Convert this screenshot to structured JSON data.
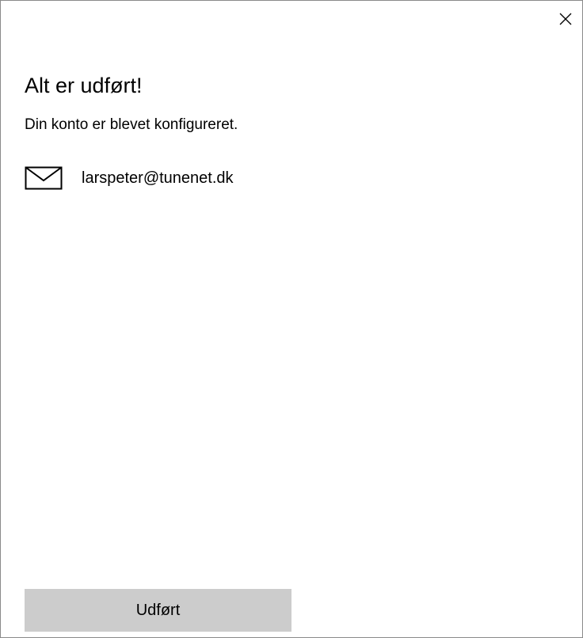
{
  "dialog": {
    "close_icon": "close-icon",
    "title": "Alt er udført!",
    "subtitle": "Din konto er blevet konfigureret.",
    "account": {
      "icon": "mail-icon",
      "email": "larspeter@tunenet.dk"
    },
    "done_button_label": "Udført"
  },
  "colors": {
    "background": "#ffffff",
    "border": "#8a8a8a",
    "button_background": "#cccccc",
    "text": "#000000"
  }
}
